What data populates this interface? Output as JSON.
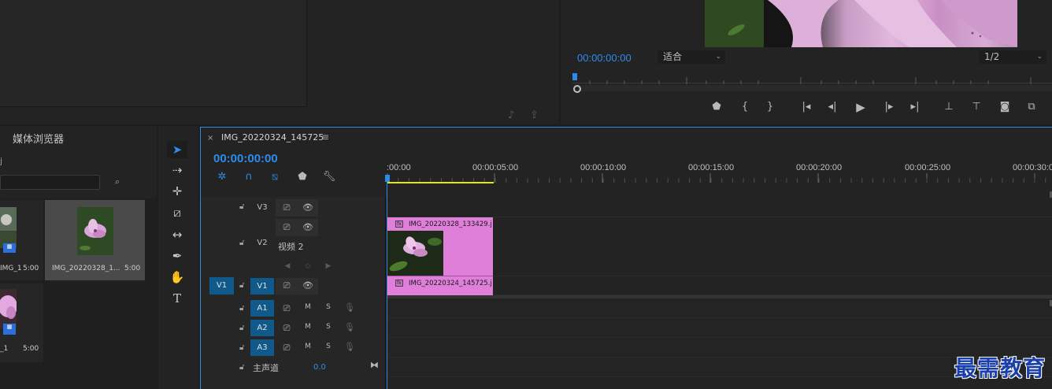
{
  "program_monitor": {
    "timecode": "00:00:00:00",
    "fit_select": "适合",
    "resolution_select": "1/2",
    "transport_icons": [
      "marker-icon",
      "in-point-icon",
      "out-point-icon",
      "go-to-in-icon",
      "step-back-icon",
      "play-icon",
      "step-forward-icon",
      "go-to-out-icon",
      "lift-icon",
      "extract-icon",
      "export-frame-icon",
      "compare-icon"
    ]
  },
  "project_panel": {
    "title": "媒体浏览器",
    "label_fragment": "j",
    "items": [
      {
        "name": "IMG_1",
        "duration": "5:00"
      },
      {
        "name": "IMG_20220328_1...",
        "duration": "5:00"
      },
      {
        "name": "_1",
        "duration": "5:00"
      }
    ]
  },
  "timeline": {
    "tab_label": "IMG_20220324_145725",
    "close_label": "×",
    "menu_label": "≡",
    "timecode": "00:00:00:00",
    "ruler_labels": [
      ":00:00",
      "00:00:05:00",
      "00:00:10:00",
      "00:00:15:00",
      "00:00:20:00",
      "00:00:25:00",
      "00:00:30:0"
    ],
    "tracks": {
      "v3": "V3",
      "v2": "V2",
      "v2_name": "视频 2",
      "v1_target": "V1",
      "v1": "V1",
      "a1": "A1",
      "a2": "A2",
      "a3": "A3",
      "mute": "M",
      "solo": "S",
      "master_label": "主声道",
      "master_value": "0.0"
    },
    "clips": {
      "v2_clip_name": "IMG_20220328_133429.j",
      "v1_clip_name": "IMG_20220324_145725.j",
      "fx_label": "fx"
    },
    "accent_color": "#2d8ceb",
    "clip_color": "#e07fd9"
  },
  "watermark": "最需教育"
}
